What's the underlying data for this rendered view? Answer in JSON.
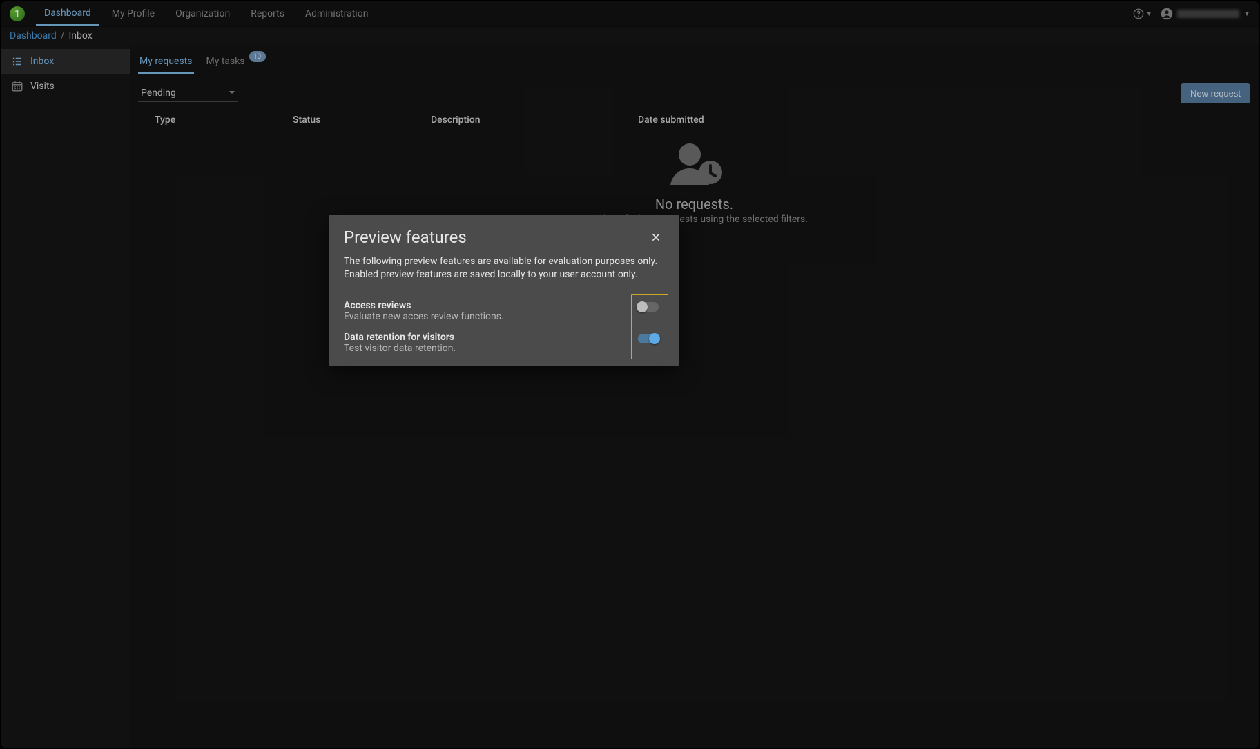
{
  "brand_badge": "1",
  "nav": {
    "items": [
      {
        "label": "Dashboard",
        "active": true
      },
      {
        "label": "My Profile"
      },
      {
        "label": "Organization"
      },
      {
        "label": "Reports"
      },
      {
        "label": "Administration"
      }
    ]
  },
  "breadcrumb": {
    "root": "Dashboard",
    "current": "Inbox"
  },
  "sidebar": {
    "items": [
      {
        "label": "Inbox",
        "icon": "list-icon",
        "active": true
      },
      {
        "label": "Visits",
        "icon": "calendar-icon"
      }
    ]
  },
  "tabs": {
    "items": [
      {
        "label": "My requests",
        "active": true
      },
      {
        "label": "My tasks",
        "badge": "10"
      }
    ]
  },
  "filter": {
    "selected": "Pending"
  },
  "actions": {
    "new_request": "New request"
  },
  "table": {
    "columns": [
      "Type",
      "Status",
      "Description",
      "Date submitted"
    ]
  },
  "empty": {
    "title": "No requests.",
    "subtitle": "Could not find any requests using the selected filters."
  },
  "dialog": {
    "title": "Preview features",
    "description": "The following preview features are available for evaluation purposes only. Enabled preview features are saved locally to your user account only.",
    "features": [
      {
        "title": "Access reviews",
        "subtitle": "Evaluate new acces review functions.",
        "enabled": false
      },
      {
        "title": "Data retention for visitors",
        "subtitle": "Test visitor data retention.",
        "enabled": true
      }
    ]
  }
}
